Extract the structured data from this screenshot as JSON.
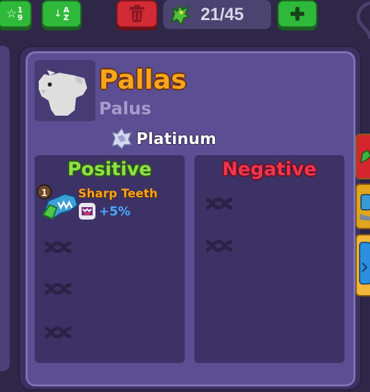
{
  "toolbar": {
    "sort_rarity_label": "1\n9",
    "sort_alpha_label": "A\nZ",
    "pet_count": "21/45",
    "delete_icon": "trash-icon",
    "add_icon": "plus-icon"
  },
  "pet": {
    "name": "Pallas",
    "species": "Palus",
    "rarity": "Platinum"
  },
  "traits": {
    "positive_header": "Positive",
    "negative_header": "Negative",
    "positive": [
      {
        "level": "1",
        "name": "Sharp Teeth",
        "bonus": "+5%"
      }
    ]
  },
  "colors": {
    "name": "#f6a51f",
    "positive": "#8fe04a",
    "negative": "#ee3650",
    "bonus": "#53a6ff",
    "panel": "#5b4e93"
  }
}
